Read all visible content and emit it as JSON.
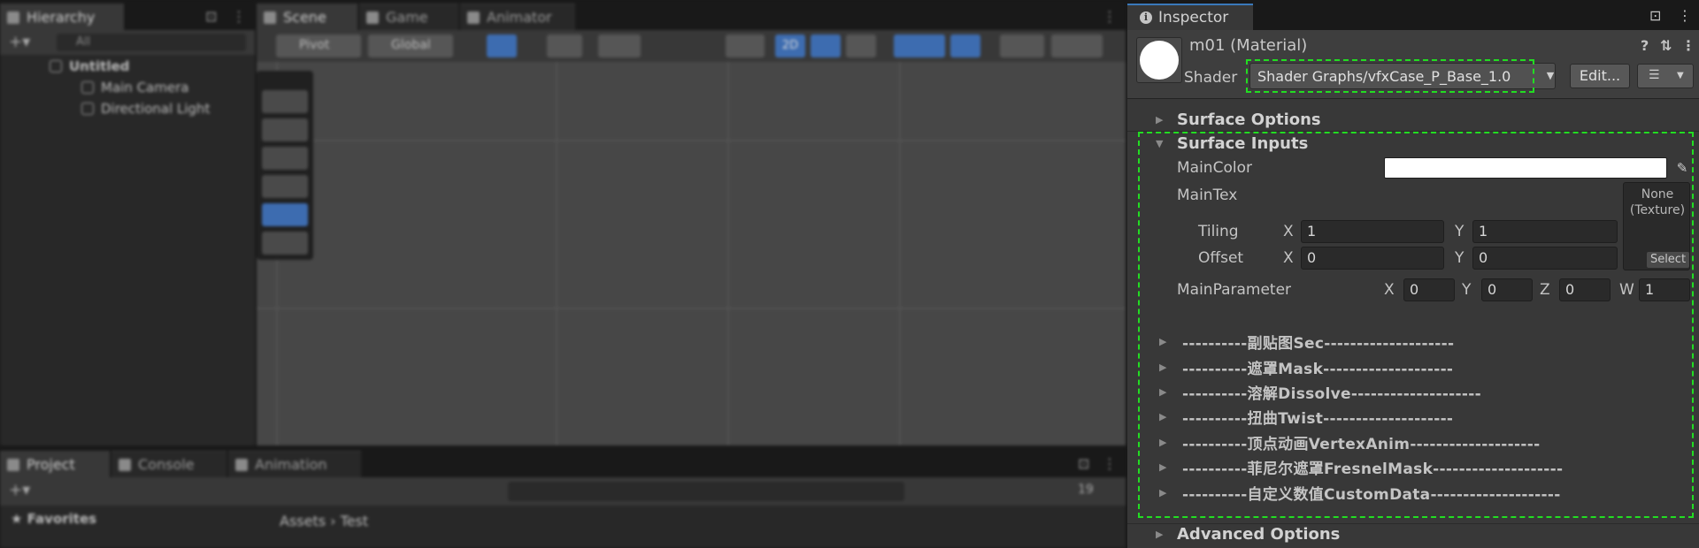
{
  "editor": {
    "hierarchy_tab": "Hierarchy",
    "scene_tab": "Scene",
    "game_tab": "Game",
    "animator_tab": "Animator",
    "search_placeholder": "All",
    "scene_root": "Untitled",
    "items": [
      "Main Camera",
      "Directional Light"
    ],
    "pivot_label": "Pivot",
    "global_label": "Global",
    "mode_2d": "2D",
    "project_tab": "Project",
    "console_tab": "Console",
    "animation_tab": "Animation",
    "favorites": "Favorites",
    "breadcrumb_assets": "Assets",
    "breadcrumb_test": "Test",
    "count_badge": "19"
  },
  "inspector": {
    "tab_label": "Inspector",
    "material_name": "m01 (Material)",
    "shader_label": "Shader",
    "shader_value": "Shader Graphs/vfxCase_P_Base_1.0",
    "edit_label": "Edit...",
    "surface_options": "Surface Options",
    "surface_inputs": "Surface Inputs",
    "main_color_label": "MainColor",
    "main_color_value": "#FFFFFF",
    "main_tex_label": "MainTex",
    "texture_none_line1": "None",
    "texture_none_line2": "(Texture)",
    "texture_select": "Select",
    "tiling_label": "Tiling",
    "offset_label": "Offset",
    "axis_x": "X",
    "axis_y": "Y",
    "axis_z": "Z",
    "axis_w": "W",
    "tiling_x": "1",
    "tiling_y": "1",
    "offset_x": "0",
    "offset_y": "0",
    "main_parameter_label": "MainParameter",
    "main_param_x": "0",
    "main_param_y": "0",
    "main_param_z": "0",
    "main_param_w": "1",
    "sections": [
      "----------副贴图Sec--------------------",
      "----------遮罩Mask--------------------",
      "----------溶解Dissolve--------------------",
      "----------扭曲Twist--------------------",
      "----------顶点动画VertexAnim--------------------",
      "----------菲尼尔遮罩FresnelMask--------------------",
      "----------自定义数值CustomData--------------------"
    ],
    "advanced_options": "Advanced Options"
  },
  "colors": {
    "highlight": "#22DD22",
    "panel_bg": "#383838",
    "accent_blue": "#3D6CB0"
  }
}
